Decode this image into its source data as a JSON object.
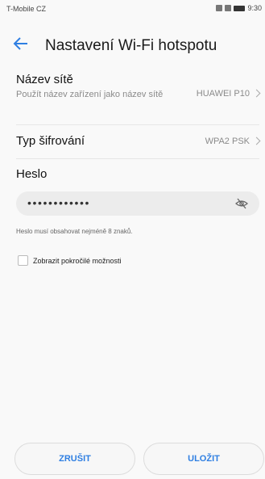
{
  "statusbar": {
    "carrier": "T-Mobile CZ",
    "time": "9:30"
  },
  "header": {
    "title": "Nastavení Wi-Fi hotspotu",
    "back_icon": "arrow-left-icon"
  },
  "network_name": {
    "label": "Název sítě",
    "description": "Použít název zařízení jako název sítě",
    "value": "HUAWEI P10"
  },
  "encryption": {
    "label": "Typ šifrování",
    "value": "WPA2 PSK"
  },
  "password": {
    "label": "Heslo",
    "masked_value": "••••••••••••",
    "hint": "Heslo musí obsahovat nejméně 8 znaků."
  },
  "advanced": {
    "label": "Zobrazit pokročilé možnosti",
    "checked": false
  },
  "actions": {
    "cancel_label": "ZRUŠIT",
    "save_label": "ULOŽIT"
  },
  "colors": {
    "accent": "#2f7fe2",
    "background": "#f9f9f9"
  }
}
